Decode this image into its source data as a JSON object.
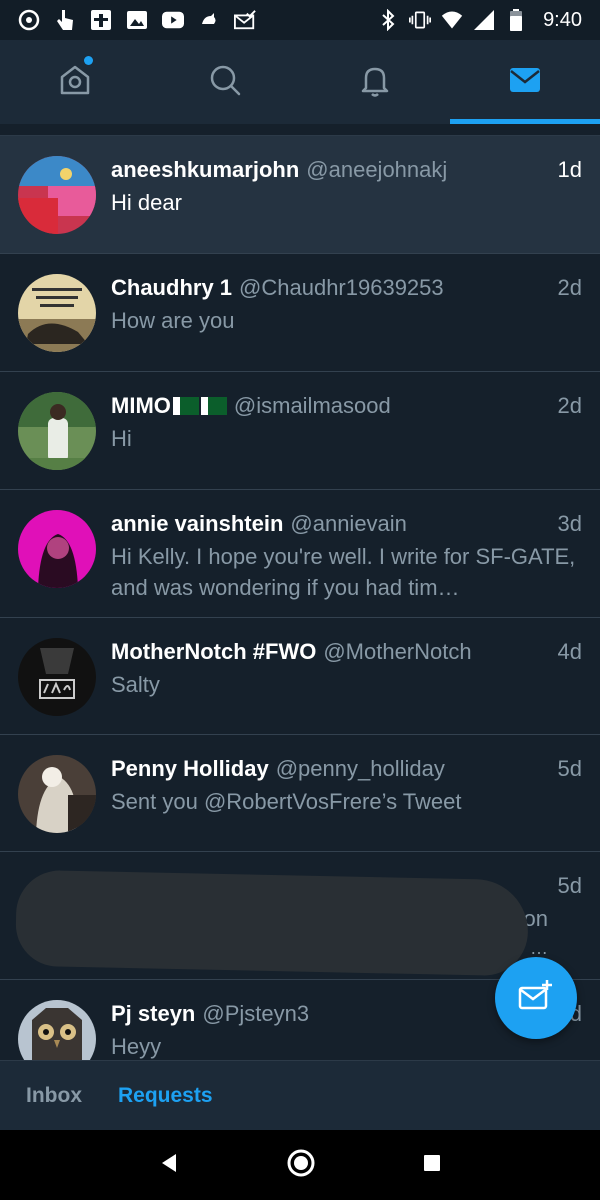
{
  "status_bar": {
    "time": "9:40",
    "left_icons": [
      "app-icon",
      "hand-icon",
      "tv-icon",
      "image-icon",
      "youtube-icon",
      "bird-icon",
      "mail-check-icon"
    ],
    "right_icons": [
      "bluetooth-icon",
      "vibrate-icon",
      "wifi-icon",
      "signal-icon",
      "battery-icon"
    ]
  },
  "top_tabs": [
    {
      "name": "home",
      "icon": "home-icon",
      "has_dot": true
    },
    {
      "name": "search",
      "icon": "search-icon"
    },
    {
      "name": "notifications",
      "icon": "bell-icon"
    },
    {
      "name": "messages",
      "icon": "mail-icon",
      "active": true
    }
  ],
  "conversations": [
    {
      "name": "aneeshkumarjohn",
      "handle": "@aneejohnakj",
      "age": "1d",
      "message": "Hi dear",
      "highlight": true
    },
    {
      "name": "Chaudhry 1",
      "handle": "@Chaudhr19639253",
      "age": "2d",
      "message": "How are you",
      "muted": true
    },
    {
      "name": "MIMO",
      "handle": "@ismailmasood",
      "age": "2d",
      "message": "Hi"
    },
    {
      "name": "annie vainshtein",
      "handle": "@annievain",
      "age": "3d",
      "message": "Hi Kelly. I hope you're well. I write for SF-GATE, and was wondering if you had tim…",
      "muted": true
    },
    {
      "name": "MotherNotch #FWO",
      "handle": "@MotherNotch",
      "age": "4d",
      "message": "Salty",
      "muted": true
    },
    {
      "name": "Penny Holliday",
      "handle": "@penny_holliday",
      "age": "5d",
      "message": "Sent you @RobertVosFrere’s Tweet",
      "muted": true
    },
    {
      "name": "",
      "handle": "",
      "age": "5d",
      "message_tail_1": "on",
      "message_tail_2": "/ …",
      "redacted": true
    },
    {
      "name": "Pj steyn",
      "handle": "@Pjsteyn3",
      "age": "d",
      "message": "Heyy",
      "muted": true
    }
  ],
  "avatar_colors": {
    "aneeshkumarjohn": "#c9354f",
    "chaudhry": "#c9b37e",
    "mimo": "#4b7a3e",
    "annie": "#e010b8",
    "mothernotch": "#111111",
    "penny": "#6b5b4f",
    "pj": "#8a8f9a"
  },
  "bottom_tabs": [
    {
      "label": "Inbox"
    },
    {
      "label": "Requests",
      "active": true
    }
  ],
  "colors": {
    "accent": "#1da1f2",
    "background": "#15202b",
    "bar": "#1c2a38"
  }
}
